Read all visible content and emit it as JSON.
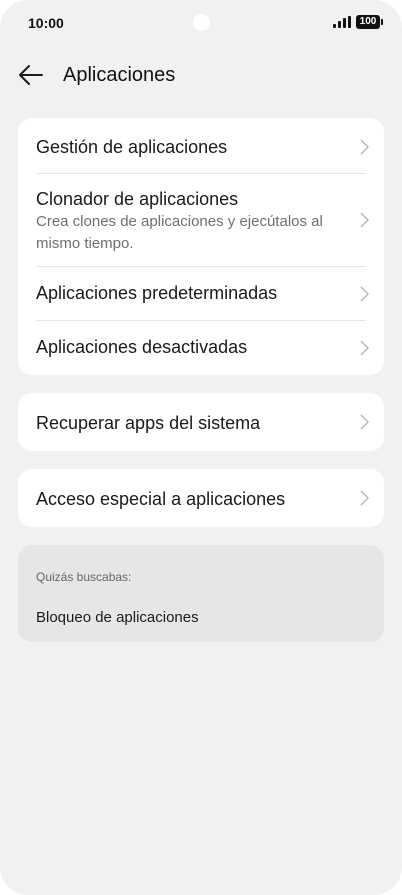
{
  "status_bar": {
    "time": "10:00",
    "battery_level": "100",
    "signal_icon": "signal-bars-icon"
  },
  "header": {
    "back_icon": "arrow-left-icon",
    "title": "Aplicaciones"
  },
  "group1": {
    "items": [
      {
        "label": "Gestión de aplicaciones"
      },
      {
        "label": "Clonador de aplicaciones",
        "description": "Crea clones de aplicaciones y ejecútalos al mismo tiempo."
      },
      {
        "label": "Aplicaciones predeterminadas"
      },
      {
        "label": "Aplicaciones desactivadas"
      }
    ]
  },
  "group2": {
    "label": "Recuperar apps del sistema"
  },
  "group3": {
    "label": "Acceso especial a aplicaciones"
  },
  "suggestions": {
    "hint": "Quizás buscabas:",
    "link": "Bloqueo de aplicaciones"
  },
  "colors": {
    "background": "#f1f1f3",
    "card": "#ffffff",
    "suggestion_card": "#e6e6e8",
    "chevron": "#b3b3b3"
  }
}
